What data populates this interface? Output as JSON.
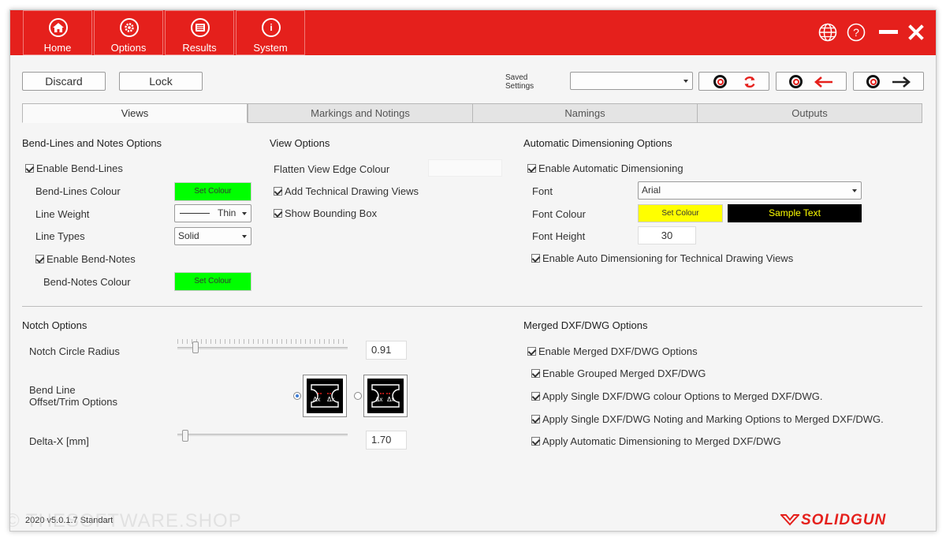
{
  "nav": {
    "home": "Home",
    "options": "Options",
    "results": "Results",
    "system": "System"
  },
  "toolbar": {
    "discard": "Discard",
    "lock": "Lock",
    "saved_settings": "Saved\nSettings",
    "saved_select_value": ""
  },
  "tabs": [
    "Views",
    "Markings and Notings",
    "Namings",
    "Outputs"
  ],
  "bend": {
    "title": "Bend-Lines and Notes Options",
    "enable_bend_lines": "Enable Bend-Lines",
    "bend_lines_colour": "Bend-Lines Colour",
    "set_colour": "Set Colour",
    "line_weight": "Line Weight",
    "line_weight_value": "Thin",
    "line_types": "Line Types",
    "line_types_value": "Solid",
    "enable_bend_notes": "Enable Bend-Notes",
    "bend_notes_colour": "Bend-Notes Colour"
  },
  "view": {
    "title": "View Options",
    "flatten_edge_colour": "Flatten View Edge Colour",
    "add_tech_views": "Add Technical Drawing Views",
    "show_bounding_box": "Show Bounding Box"
  },
  "autodim": {
    "title": "Automatic Dimensioning Options",
    "enable": "Enable Automatic Dimensioning",
    "font": "Font",
    "font_value": "Arial",
    "font_colour": "Font Colour",
    "set_colour": "Set Colour",
    "sample_text": "Sample Text",
    "font_height": "Font Height",
    "font_height_value": "30",
    "enable_auto_tech": "Enable Auto Dimensioning for Technical Drawing Views"
  },
  "notch": {
    "title": "Notch Options",
    "radius_label": "Notch Circle Radius",
    "radius_value": "0.91",
    "radius_fraction": 0.09,
    "bend_line_offset": "Bend Line\nOffset/Trim Options",
    "dx": "Δx",
    "delta_label": "Delta-X [mm]",
    "delta_value": "1.70",
    "delta_fraction": 0.03
  },
  "merged": {
    "title": "Merged DXF/DWG Options",
    "enable_merged": "Enable Merged DXF/DWG Options",
    "enable_grouped": "Enable Grouped Merged DXF/DWG",
    "apply_colour": "Apply Single DXF/DWG colour Options to Merged DXF/DWG.",
    "apply_noting": "Apply Single DXF/DWG Noting and Marking Options to Merged DXF/DWG.",
    "apply_autodim": "Apply Automatic Dimensioning to Merged DXF/DWG"
  },
  "footer": {
    "version": "2020 v5.0.1.7 Standart",
    "watermark": "© THESOFTWARE.SHOP",
    "brand": "SOLIDGUN"
  },
  "colors": {
    "brand_red": "#e5201c",
    "bend_colour": "#00ff00",
    "font_colour": "#ffff00",
    "sample_bg": "#000000",
    "sample_fg": "#ffff00"
  }
}
